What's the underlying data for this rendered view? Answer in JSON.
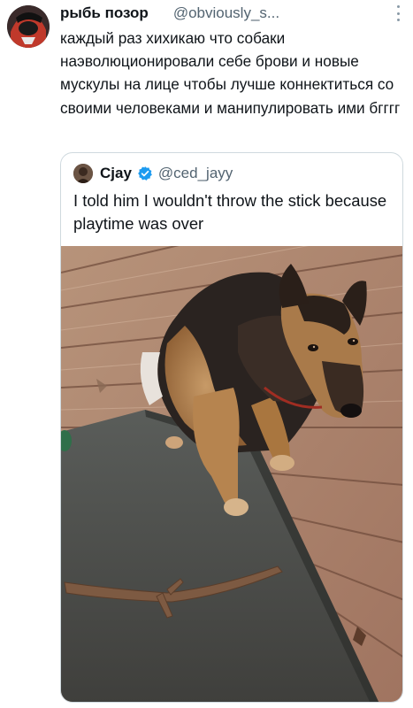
{
  "tweet": {
    "display_name": "рыбь позор",
    "handle": "@obviously_s...",
    "text": "каждый раз хихикаю что собаки наэволюционировали себе брови и новые мускулы на лице чтобы лучше коннектиться со своими человеками и манипулировать ими бгггг"
  },
  "quote": {
    "display_name": "Cjay",
    "handle": "@ced_jayy",
    "text": "I told him I wouldn't throw the stick because playtime was over",
    "verified_color": "#1d9bf0"
  },
  "icons": {
    "more": "more-vertical-icon",
    "verified": "verified-badge-icon"
  },
  "colors": {
    "text": "#0f1419",
    "muted": "#536471",
    "border": "#cfd9de"
  }
}
